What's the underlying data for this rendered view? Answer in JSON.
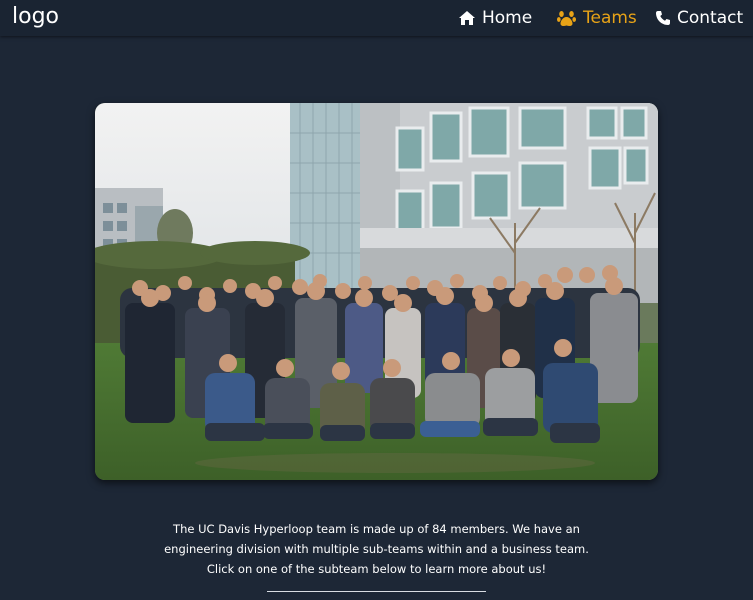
{
  "nav": {
    "logo": "logo",
    "links": [
      {
        "label": "Home",
        "icon": "home-icon",
        "active": false
      },
      {
        "label": "Teams",
        "icon": "paw-icon",
        "active": true
      },
      {
        "label": "Contact",
        "icon": "phone-icon",
        "active": false
      }
    ]
  },
  "hero": {
    "image": "team-group-photo"
  },
  "intro": {
    "text": "The UC Davis Hyperloop team is made up of 84 members. We have an engineering division with multiple sub-teams within and a business team. Click on one of the subteam below to learn more about us!"
  },
  "colors": {
    "background": "#1d2736",
    "navbar": "#1a2432",
    "accent": "#e8a317",
    "text": "#ffffff"
  }
}
